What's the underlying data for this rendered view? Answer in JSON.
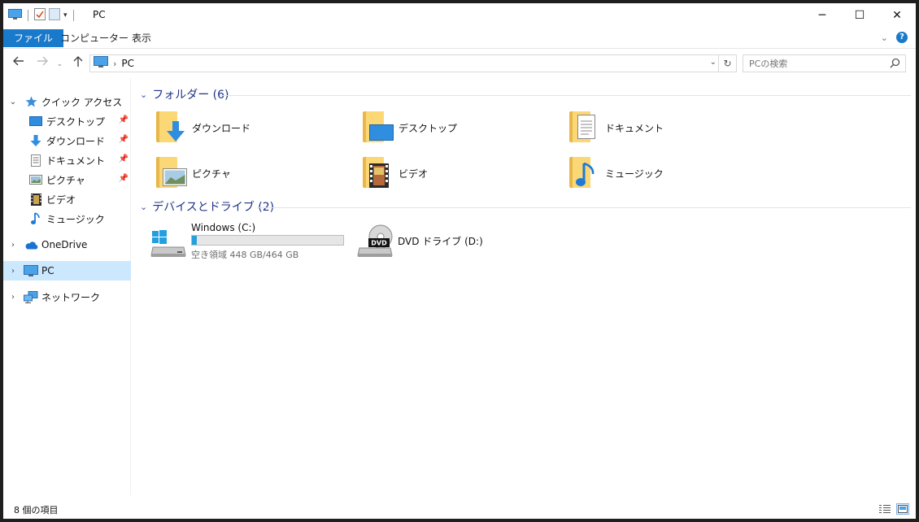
{
  "window": {
    "title": "PC",
    "controls": {
      "minimize": "─",
      "maximize": "☐",
      "close": "✕"
    }
  },
  "ribbon": {
    "tabs": [
      "ファイル",
      "コンピューター",
      "表示"
    ],
    "help": "?"
  },
  "address": {
    "path": "PC",
    "search_placeholder": "PCの検索"
  },
  "sidebar": {
    "quick_access": "クイック アクセス",
    "quick_items": [
      {
        "label": "デスクトップ",
        "icon": "desktop-icon",
        "pinned": true
      },
      {
        "label": "ダウンロード",
        "icon": "download-icon",
        "pinned": true
      },
      {
        "label": "ドキュメント",
        "icon": "document-icon",
        "pinned": true
      },
      {
        "label": "ピクチャ",
        "icon": "picture-icon",
        "pinned": true
      },
      {
        "label": "ビデオ",
        "icon": "video-icon",
        "pinned": false
      },
      {
        "label": "ミュージック",
        "icon": "music-icon",
        "pinned": false
      }
    ],
    "onedrive": "OneDrive",
    "pc": "PC",
    "network": "ネットワーク"
  },
  "content": {
    "folders_header": "フォルダー (6)",
    "folders": [
      {
        "label": "ダウンロード",
        "icon": "download-folder-icon"
      },
      {
        "label": "デスクトップ",
        "icon": "desktop-folder-icon"
      },
      {
        "label": "ドキュメント",
        "icon": "documents-folder-icon"
      },
      {
        "label": "ピクチャ",
        "icon": "pictures-folder-icon"
      },
      {
        "label": "ビデオ",
        "icon": "videos-folder-icon"
      },
      {
        "label": "ミュージック",
        "icon": "music-folder-icon"
      }
    ],
    "drives_header": "デバイスとドライブ (2)",
    "drives": [
      {
        "label": "Windows (C:)",
        "free_text": "空き領域 448 GB/464 GB",
        "used_fraction": 0.034,
        "icon": "windows-drive-icon"
      },
      {
        "label": "DVD ドライブ (D:)",
        "icon": "dvd-drive-icon",
        "badge": "DVD"
      }
    ]
  },
  "statusbar": {
    "item_count": "8 個の項目"
  },
  "colors": {
    "accent": "#1979ca",
    "header_text": "#1e3287",
    "selected": "#cce8ff",
    "folder": "#fcd776",
    "progress": "#26a0da"
  }
}
